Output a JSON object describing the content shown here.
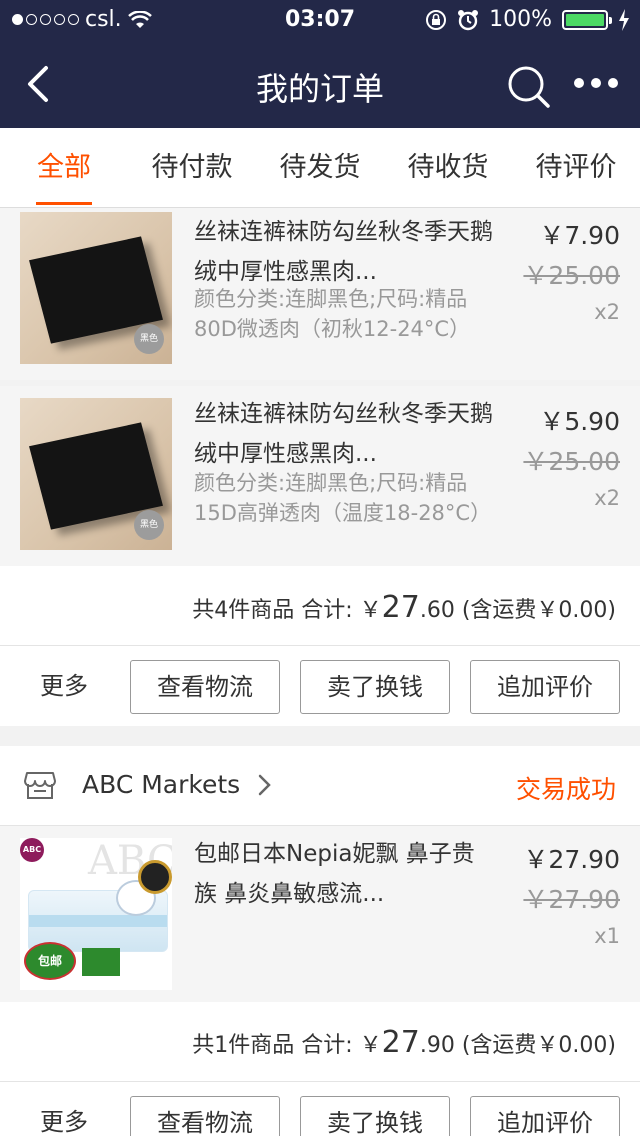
{
  "status_bar": {
    "carrier": "csl.",
    "time": "03:07",
    "battery": "100%"
  },
  "nav": {
    "title": "我的订单"
  },
  "tabs": [
    {
      "label": "全部",
      "active": true
    },
    {
      "label": "待付款",
      "active": false
    },
    {
      "label": "待发货",
      "active": false
    },
    {
      "label": "待收货",
      "active": false
    },
    {
      "label": "待评价",
      "active": false
    }
  ],
  "order1": {
    "items": [
      {
        "name": "丝袜连裤袜防勾丝秋冬季天鹅绒中厚性感黑肉...",
        "sku": "颜色分类:连脚黑色;尺码:精品80D微透肉（初秋12-24°C）",
        "price": "￥7.90",
        "original_price": "￥25.00",
        "quantity": "x2",
        "badge": "黑色"
      },
      {
        "name": "丝袜连裤袜防勾丝秋冬季天鹅绒中厚性感黑肉...",
        "sku": "颜色分类:连脚黑色;尺码:精品15D高弹透肉（温度18-28°C）",
        "price": "￥5.90",
        "original_price": "￥25.00",
        "quantity": "x2",
        "badge": "黑色"
      }
    ],
    "summary": {
      "count_text": "共4件商品",
      "total_label": "合计:",
      "currency": "￥",
      "total_int": "27",
      "total_dec": ".60",
      "shipping": "(含运费￥0.00)"
    },
    "actions": {
      "more": "更多",
      "logistics": "查看物流",
      "resell": "卖了换钱",
      "review": "追加评价"
    }
  },
  "order2": {
    "shop_name": "ABC Markets",
    "status": "交易成功",
    "items": [
      {
        "name": "包邮日本Nepia妮飘 鼻子贵族 鼻炎鼻敏感流...",
        "price": "￥27.90",
        "original_price": "￥27.90",
        "quantity": "x1",
        "thumb_logo": "ABC",
        "thumb_free": "包邮"
      }
    ],
    "summary": {
      "count_text": "共1件商品",
      "total_label": "合计:",
      "currency": "￥",
      "total_int": "27",
      "total_dec": ".90",
      "shipping": "(含运费￥0.00)"
    },
    "actions": {
      "more": "更多",
      "logistics": "查看物流",
      "resell": "卖了换钱",
      "review": "追加评价"
    }
  },
  "colors": {
    "nav_bg": "#232848",
    "accent": "#ff5000"
  }
}
